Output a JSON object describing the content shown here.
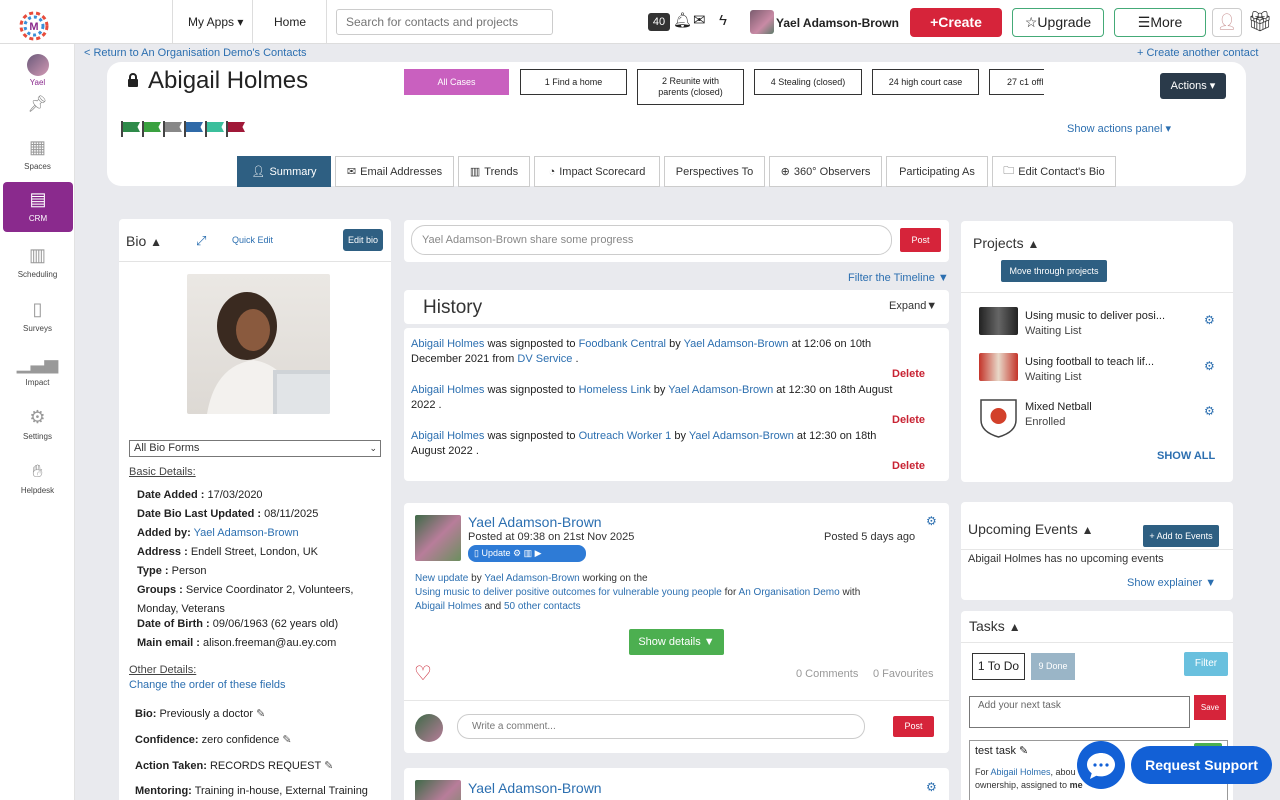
{
  "topbar": {
    "my_apps": "My Apps ▾",
    "home": "Home",
    "search_placeholder": "Search for contacts and projects",
    "notif_count": "40",
    "user_name": "Yael Adamson-Brown",
    "create": "Create",
    "upgrade": "Upgrade",
    "more": "More"
  },
  "sidebar": {
    "user": "Yael",
    "items": [
      "Spaces",
      "CRM",
      "Scheduling",
      "Surveys",
      "Impact",
      "Settings",
      "Helpdesk"
    ]
  },
  "links": {
    "return": "< Return to An Organisation Demo's Contacts",
    "create_another": "+ Create another contact"
  },
  "contact": {
    "name": "Abigail Holmes",
    "actions": "Actions ▾",
    "show_actions_panel": "Show actions panel ▾",
    "flag_colors": [
      "#2e8a4a",
      "#3aa140",
      "#888888",
      "#2f6aa8",
      "#3bbf9c",
      "#a01838"
    ]
  },
  "cases": [
    "All Cases",
    "1 Find a home",
    "2 Reunite with parents (closed)",
    "4 Stealing (closed)",
    "24 high court case",
    "27 c1 offl"
  ],
  "tabs": [
    "Summary",
    "Email Addresses",
    "Trends",
    "Impact Scorecard",
    "Perspectives To",
    "360° Observers",
    "Participating As",
    "Edit Contact's Bio"
  ],
  "bio": {
    "title": "Bio",
    "quick_edit": "Quick Edit",
    "edit_bio": "Edit bio",
    "forms_select": "All Bio Forms",
    "basic_details": "Basic Details:",
    "date_added_label": "Date Added :",
    "date_added": "17/03/2020",
    "updated_label": "Date Bio Last Updated :",
    "updated": "08/11/2025",
    "added_by_label": "Added by:",
    "added_by": "Yael Adamson-Brown",
    "address_label": "Address :",
    "address": "Endell Street, London, UK",
    "type_label": "Type :",
    "type": "Person",
    "groups_label": "Groups :",
    "groups": "Service Coordinator 2, Volunteers,",
    "groups2": "Monday, Veterans",
    "dob_label": "Date of Birth :",
    "dob": "09/06/1963 (62 years old)",
    "email_label": "Main email :",
    "email": "alison.freeman@au.ey.com",
    "other_details": "Other Details:",
    "change_order": "Change the order of these fields",
    "bio_label": "Bio:",
    "bio_value": "Previously a doctor",
    "confidence_label": "Confidence:",
    "confidence_value": "zero confidence",
    "action_label": "Action Taken:",
    "action_value": "RECORDS REQUEST",
    "mentoring_label": "Mentoring:",
    "mentoring_value": "Training in-house, External Training"
  },
  "feed": {
    "post_placeholder": "Yael Adamson-Brown share some progress",
    "post": "Post",
    "filter_timeline": "Filter the Timeline ▼",
    "history_title": "History",
    "expand": "Expand▼",
    "delete": "Delete",
    "history": [
      {
        "who": "Abigail Holmes",
        "to": "Foodbank Central",
        "by": "Yael Adamson-Brown",
        "when": "at 12:06 on 10th December 2021 from",
        "from": "DV Service",
        "end": "."
      },
      {
        "who": "Abigail Holmes",
        "to": "Homeless Link",
        "by": "Yael Adamson-Brown",
        "when": "at 12:30 on 18th August 2022 .",
        "from": "",
        "end": ""
      },
      {
        "who": "Abigail Holmes",
        "to": "Outreach Worker 1",
        "by": "Yael Adamson-Brown",
        "when": "at 12:30 on 18th August 2022 .",
        "from": "",
        "end": ""
      }
    ],
    "signposted_text": "was signposted to",
    "by_text": "by",
    "card_name": "Yael Adamson-Brown",
    "card_posted": "Posted at 09:38 on 21st Nov 2025",
    "card_ago": "Posted 5 days ago",
    "update_label": "Update",
    "update_pre": "New update",
    "update_by": "by",
    "update_who": "Yael Adamson-Brown",
    "update_mid": "working on the",
    "update_project": "Using music to deliver positive outcomes for vulnerable young people",
    "update_for": "for",
    "update_org": "An Organisation Demo",
    "update_with": "with",
    "update_contact": "Abigail Holmes",
    "update_and": "and",
    "update_others": "50 other contacts",
    "show_details": "Show details ▼",
    "comments": "0 Comments",
    "favourites": "0 Favourites",
    "comment_placeholder": "Write a comment...",
    "comment_post": "Post"
  },
  "projects": {
    "title": "Projects",
    "move": "Move through projects",
    "items": [
      {
        "name": "Using music to deliver posi...",
        "status": "Waiting List"
      },
      {
        "name": "Using football to teach lif...",
        "status": "Waiting List"
      },
      {
        "name": "Mixed Netball",
        "status": "Enrolled"
      }
    ],
    "show_all": "SHOW ALL"
  },
  "events": {
    "title": "Upcoming Events",
    "add": "+ Add to Events",
    "none": "Abigail Holmes has no upcoming events",
    "show_explainer": "Show explainer ▼"
  },
  "tasks": {
    "title": "Tasks",
    "todo": "1 To Do",
    "done": "9 Done",
    "filter": "Filter",
    "placeholder": "Add your next task",
    "save": "Save",
    "item_title": "test task",
    "item_for": "For",
    "item_contact": "Abigail Holmes",
    "item_rest": ", abou",
    "item_line2": "ownership, assigned to",
    "item_me": "me"
  },
  "support": {
    "label": "Request Support"
  }
}
